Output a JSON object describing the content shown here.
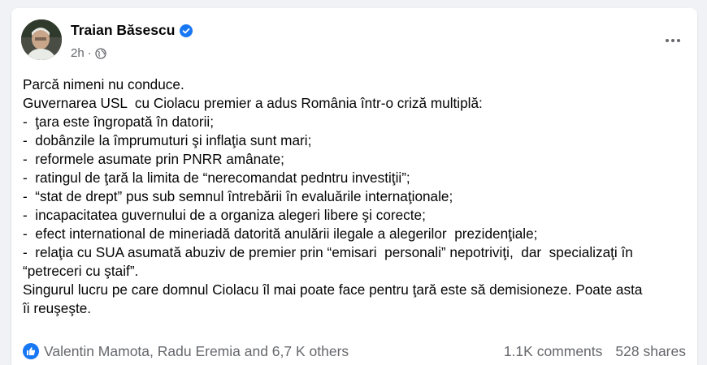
{
  "post": {
    "author": "Traian Băsescu",
    "time": "2h",
    "separator": "·",
    "lines": [
      "Parcă nimeni nu conduce.",
      "Guvernarea USL  cu Ciolacu premier a adus România într-o criză multiplă:",
      "-  ţara este îngropată în datorii;",
      "-  dobânzile la împrumuturi şi inflaţia sunt mari;",
      "-  reformele asumate prin PNRR amânate;",
      "-  ratingul de ţară la limita de “nerecomandat pedntru investiţii”;",
      "-  “stat de drept” pus sub semnul întrebării în evaluările internaţionale;",
      "-  incapacitatea guvernului de a organiza alegeri libere şi corecte;",
      "-  efect international de mineriadă datorită anulării ilegale a alegerilor  prezidenţiale;",
      "-  relaţia cu SUA asumată abuziv de premier prin “emisari  personali” nepotriviţi,  dar  specializaţi în",
      "“petreceri cu ştaif”.",
      "Singurul lucru pe care domnul Ciolacu îl mai poate face pentru ţară este să demisioneze. Poate asta",
      "îi reuşeşte."
    ]
  },
  "footer": {
    "reactions_text": "Valentin Mamota, Radu Eremia and 6,7 K others",
    "comments": "1.1K comments",
    "shares": "528 shares"
  },
  "icons": {
    "verified": "verified-badge-icon",
    "globe": "globe-icon",
    "more": "more-options-icon",
    "like": "like-reaction-icon"
  },
  "colors": {
    "brand_blue": "#1877f2",
    "secondary_text": "#65676b",
    "primary_text": "#050505"
  }
}
